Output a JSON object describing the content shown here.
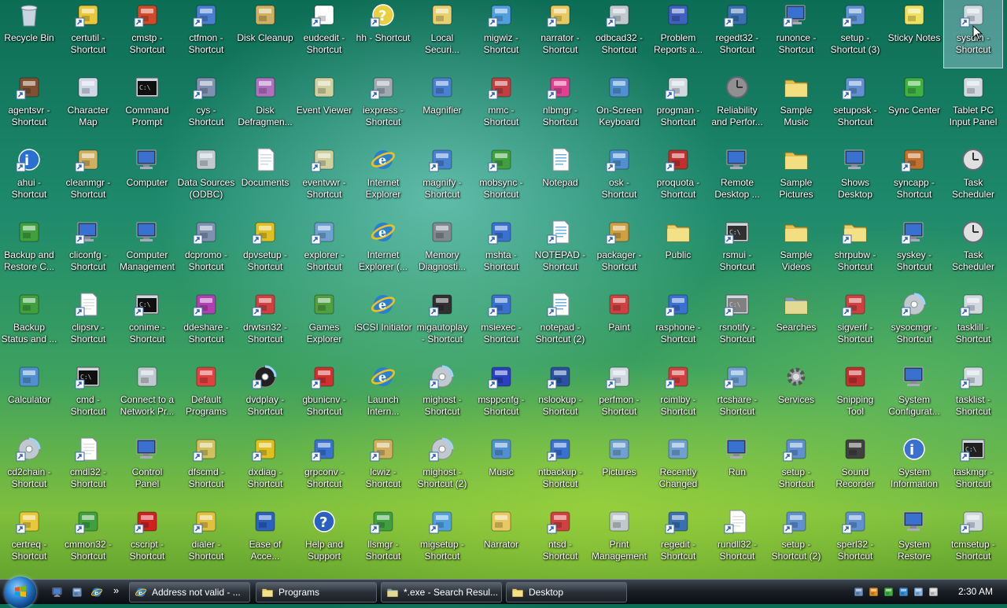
{
  "desktop": {
    "icons": [
      {
        "label": "Recycle Bin",
        "icon": "recycle-bin-icon",
        "color": "#c8d4e0"
      },
      {
        "label": "certutil -\nShortcut",
        "icon": "certificate-icon",
        "color": "#e8c83a"
      },
      {
        "label": "cmstp -\nShortcut",
        "icon": "connection-icon",
        "color": "#d04a2a"
      },
      {
        "label": "ctfmon -\nShortcut",
        "icon": "keyboard-window-icon",
        "color": "#4a7fd0"
      },
      {
        "label": "Disk Cleanup",
        "icon": "disk-cleanup-icon",
        "color": "#d0b060"
      },
      {
        "label": "eudcedit -\nShortcut",
        "icon": "char-editor-icon",
        "color": "#ffffff"
      },
      {
        "label": "hh - Shortcut",
        "icon": "help-file-icon",
        "color": "#e8d040"
      },
      {
        "label": "Local\nSecuri...",
        "icon": "security-policy-icon",
        "color": "#e8d070"
      },
      {
        "label": "migwiz -\nShortcut",
        "icon": "migration-icon",
        "color": "#50a0e0"
      },
      {
        "label": "narrator -\nShortcut",
        "icon": "narrator-icon",
        "color": "#e8c860"
      },
      {
        "label": "odbcad32 -\nShortcut",
        "icon": "odbc-icon",
        "color": "#c0c8d0"
      },
      {
        "label": "Problem\nReports a...",
        "icon": "problem-reports-icon",
        "color": "#4060c0"
      },
      {
        "label": "regedt32 -\nShortcut",
        "icon": "registry-icon",
        "color": "#3a70b0"
      },
      {
        "label": "runonce -\nShortcut",
        "icon": "computer-icon",
        "color": "#3a70d0"
      },
      {
        "label": "setup -\nShortcut (3)",
        "icon": "setup-icon",
        "color": "#6090d0"
      },
      {
        "label": "Sticky Notes",
        "icon": "sticky-notes-icon",
        "color": "#f0e060"
      },
      {
        "label": "sysdm -\nShortcut",
        "icon": "system-properties-icon",
        "color": "#d0d8e0"
      },
      {
        "label": "agentsvr -\nShortcut",
        "icon": "agent-icon",
        "color": "#805030"
      },
      {
        "label": "Character\nMap",
        "icon": "character-map-icon",
        "color": "#d0d8e8"
      },
      {
        "label": "Command\nPrompt",
        "icon": "command-prompt-icon",
        "color": "#101010"
      },
      {
        "label": "cys -\nShortcut",
        "icon": "server-icon",
        "color": "#8090b0"
      },
      {
        "label": "Disk\nDefragmen...",
        "icon": "defrag-icon",
        "color": "#b070c0"
      },
      {
        "label": "Event Viewer",
        "icon": "event-viewer-icon",
        "color": "#d0d0a0"
      },
      {
        "label": "iexpress -\nShortcut",
        "icon": "iexpress-icon",
        "color": "#a0a8b0"
      },
      {
        "label": "Magnifier",
        "icon": "magnifier-icon",
        "color": "#4a80d0"
      },
      {
        "label": "mmc -\nShortcut",
        "icon": "mmc-icon",
        "color": "#c04040"
      },
      {
        "label": "nlbmgr -\nShortcut",
        "icon": "pie-chart-icon",
        "color": "#e04090"
      },
      {
        "label": "On-Screen\nKeyboard",
        "icon": "on-screen-keyboard-icon",
        "color": "#5090d0"
      },
      {
        "label": "progman -\nShortcut",
        "icon": "program-manager-icon",
        "color": "#d0d8e0"
      },
      {
        "label": "Reliability\nand Perfor...",
        "icon": "gauge-icon",
        "color": "#909090"
      },
      {
        "label": "Sample\nMusic",
        "icon": "music-folder-icon",
        "color": "#e0c050"
      },
      {
        "label": "setuposk -\nShortcut",
        "icon": "setup-icon",
        "color": "#6090d0"
      },
      {
        "label": "Sync Center",
        "icon": "sync-center-icon",
        "color": "#40b040"
      },
      {
        "label": "Tablet PC\nInput Panel",
        "icon": "tablet-input-icon",
        "color": "#d0d8e0"
      },
      {
        "label": "ahui -\nShortcut",
        "icon": "info-icon",
        "color": "#2a70d0"
      },
      {
        "label": "cleanmgr -\nShortcut",
        "icon": "disk-cleanup-icon",
        "color": "#d0b060"
      },
      {
        "label": "Computer",
        "icon": "computer-icon",
        "color": "#3a70d0"
      },
      {
        "label": "Data Sources\n(ODBC)",
        "icon": "odbc-icon",
        "color": "#c0c8d0"
      },
      {
        "label": "Documents",
        "icon": "documents-icon",
        "color": "#d0d8e8"
      },
      {
        "label": "eventvwr -\nShortcut",
        "icon": "event-viewer-icon",
        "color": "#d0d0a0"
      },
      {
        "label": "Internet\nExplorer",
        "icon": "internet-explorer-icon",
        "color": "#2a80d0"
      },
      {
        "label": "magnify -\nShortcut",
        "icon": "magnifier-icon",
        "color": "#4a80d0"
      },
      {
        "label": "mobsync -\nShortcut",
        "icon": "sync-icon",
        "color": "#40a040"
      },
      {
        "label": "Notepad",
        "icon": "notepad-icon",
        "color": "#70b0e0"
      },
      {
        "label": "osk -\nShortcut",
        "icon": "on-screen-keyboard-icon",
        "color": "#5090d0"
      },
      {
        "label": "proquota -\nShortcut",
        "icon": "quota-icon",
        "color": "#c03030"
      },
      {
        "label": "Remote\nDesktop ...",
        "icon": "remote-desktop-icon",
        "color": "#3a70d0"
      },
      {
        "label": "Sample\nPictures",
        "icon": "pictures-folder-icon",
        "color": "#e0c050"
      },
      {
        "label": "Shows\nDesktop",
        "icon": "show-desktop-icon",
        "color": "#3a70d0"
      },
      {
        "label": "syncapp -\nShortcut",
        "icon": "briefcase-icon",
        "color": "#c07030"
      },
      {
        "label": "Task\nScheduler",
        "icon": "clock-icon",
        "color": "#e0e0e0"
      },
      {
        "label": "Backup and\nRestore C...",
        "icon": "backup-icon",
        "color": "#40a040"
      },
      {
        "label": "cliconfg -\nShortcut",
        "icon": "computer-icon",
        "color": "#3a70d0"
      },
      {
        "label": "Computer\nManagement",
        "icon": "computer-management-icon",
        "color": "#3a70d0"
      },
      {
        "label": "dcpromo -\nShortcut",
        "icon": "server-icon",
        "color": "#8090b0"
      },
      {
        "label": "dpvsetup -\nShortcut",
        "icon": "directx-icon",
        "color": "#e0c020"
      },
      {
        "label": "explorer -\nShortcut",
        "icon": "explorer-icon",
        "color": "#70a0d0"
      },
      {
        "label": "Internet\nExplorer (...",
        "icon": "internet-explorer-icon",
        "color": "#2a80d0"
      },
      {
        "label": "Memory\nDiagnosti...",
        "icon": "memory-icon",
        "color": "#808890"
      },
      {
        "label": "mshta -\nShortcut",
        "icon": "window-icon",
        "color": "#3a70d0"
      },
      {
        "label": "NOTEPAD -\nShortcut",
        "icon": "notepad-icon",
        "color": "#70b0e0"
      },
      {
        "label": "packager -\nShortcut",
        "icon": "package-icon",
        "color": "#d0a040"
      },
      {
        "label": "Public",
        "icon": "folder-icon",
        "color": "#e8d070"
      },
      {
        "label": "rsmui -\nShortcut",
        "icon": "storage-icon",
        "color": "#303030"
      },
      {
        "label": "Sample\nVideos",
        "icon": "videos-folder-icon",
        "color": "#e0c050"
      },
      {
        "label": "shrpubw -\nShortcut",
        "icon": "shared-folder-icon",
        "color": "#e8d070"
      },
      {
        "label": "syskey -\nShortcut",
        "icon": "key-computer-icon",
        "color": "#3a70d0"
      },
      {
        "label": "Task\nScheduler",
        "icon": "clock-icon",
        "color": "#e0e0e0"
      },
      {
        "label": "Backup\nStatus and ...",
        "icon": "backup-icon",
        "color": "#40a040"
      },
      {
        "label": "clipsrv -\nShortcut",
        "icon": "clipboard-icon",
        "color": "#e0e0e0"
      },
      {
        "label": "conime -\nShortcut",
        "icon": "command-prompt-icon",
        "color": "#101010"
      },
      {
        "label": "ddeshare -\nShortcut",
        "icon": "dde-icon",
        "color": "#b040b0"
      },
      {
        "label": "drwtsn32 -\nShortcut",
        "icon": "doctor-watson-icon",
        "color": "#d04040"
      },
      {
        "label": "Games\nExplorer",
        "icon": "games-icon",
        "color": "#50a040"
      },
      {
        "label": "iSCSI Initiator",
        "icon": "globe-icon",
        "color": "#2a80d0"
      },
      {
        "label": "migautoplay\n- Shortcut",
        "icon": "autoplay-icon",
        "color": "#303030"
      },
      {
        "label": "msiexec -\nShortcut",
        "icon": "installer-icon",
        "color": "#3a70d0"
      },
      {
        "label": "notepad -\nShortcut (2)",
        "icon": "notepad-icon",
        "color": "#70b0e0"
      },
      {
        "label": "Paint",
        "icon": "paint-icon",
        "color": "#d04040"
      },
      {
        "label": "rasphone -\nShortcut",
        "icon": "network-icon",
        "color": "#3a70d0"
      },
      {
        "label": "rsnotify -\nShortcut",
        "icon": "storage-icon",
        "color": "#808080"
      },
      {
        "label": "Searches",
        "icon": "search-folder-icon",
        "color": "#70a0d0"
      },
      {
        "label": "sigverif -\nShortcut",
        "icon": "signature-icon",
        "color": "#d04040"
      },
      {
        "label": "sysocmgr -\nShortcut",
        "icon": "cd-icon",
        "color": "#c0c8d0"
      },
      {
        "label": "tasklill -\nShortcut",
        "icon": "window-icon",
        "color": "#d0d8e0"
      },
      {
        "label": "Calculator",
        "icon": "calculator-icon",
        "color": "#5090d0"
      },
      {
        "label": "cmd -\nShortcut",
        "icon": "command-prompt-icon",
        "color": "#101010"
      },
      {
        "label": "Connect to a\nNetwork Pr...",
        "icon": "printer-icon",
        "color": "#c0c8d0"
      },
      {
        "label": "Default\nPrograms",
        "icon": "default-programs-icon",
        "color": "#e04040"
      },
      {
        "label": "dvdplay -\nShortcut",
        "icon": "dvd-icon",
        "color": "#202020"
      },
      {
        "label": "gbunicnv -\nShortcut",
        "icon": "chinese-char-icon",
        "color": "#d03030"
      },
      {
        "label": "Launch\nIntern...",
        "icon": "internet-explorer-icon",
        "color": "#2a80d0"
      },
      {
        "label": "mighost -\nShortcut",
        "icon": "cd-icon",
        "color": "#c0c8d0"
      },
      {
        "label": "msppcnfg -\nShortcut",
        "icon": "config-icon",
        "color": "#2a40c0"
      },
      {
        "label": "nslookup -\nShortcut",
        "icon": "network-tree-icon",
        "color": "#2a50a0"
      },
      {
        "label": "perfmon -\nShortcut",
        "icon": "performance-icon",
        "color": "#d0d8e0"
      },
      {
        "label": "rcimlby -\nShortcut",
        "icon": "ime-icon",
        "color": "#d04040"
      },
      {
        "label": "rtcshare -\nShortcut",
        "icon": "share-icon",
        "color": "#70a0d0"
      },
      {
        "label": "Services",
        "icon": "gear-icon",
        "color": "#a0a8b0"
      },
      {
        "label": "Snipping\nTool",
        "icon": "scissors-icon",
        "color": "#c03030"
      },
      {
        "label": "System\nConfigurat...",
        "icon": "system-config-icon",
        "color": "#3a70d0"
      },
      {
        "label": "tasklist -\nShortcut",
        "icon": "window-icon",
        "color": "#d0d8e0"
      },
      {
        "label": "cd2chain -\nShortcut",
        "icon": "cd-icon",
        "color": "#c0c8d0"
      },
      {
        "label": "cmdl32 -\nShortcut",
        "icon": "document-icon",
        "color": "#e0e0e0"
      },
      {
        "label": "Control\nPanel",
        "icon": "control-panel-icon",
        "color": "#3a70d0"
      },
      {
        "label": "dfscmd -\nShortcut",
        "icon": "dfs-icon",
        "color": "#d0c060"
      },
      {
        "label": "dxdiag -\nShortcut",
        "icon": "directx-icon",
        "color": "#e0c020"
      },
      {
        "label": "grpconv -\nShortcut",
        "icon": "program-group-icon",
        "color": "#3a70d0"
      },
      {
        "label": "lcwiz -\nShortcut",
        "icon": "wizard-icon",
        "color": "#d0b060"
      },
      {
        "label": "mighost -\nShortcut (2)",
        "icon": "cd-icon",
        "color": "#c0c8d0"
      },
      {
        "label": "Music",
        "icon": "music-icon",
        "color": "#5090d0"
      },
      {
        "label": "ntbackup -\nShortcut",
        "icon": "backup-tape-icon",
        "color": "#3a70d0"
      },
      {
        "label": "Pictures",
        "icon": "pictures-icon",
        "color": "#70a0d0"
      },
      {
        "label": "Recently\nChanged",
        "icon": "recent-icon",
        "color": "#70a0d0"
      },
      {
        "label": "Run",
        "icon": "run-icon",
        "color": "#3a70d0"
      },
      {
        "label": "setup -\nShortcut",
        "icon": "setup-icon",
        "color": "#6090d0"
      },
      {
        "label": "Sound\nRecorder",
        "icon": "microphone-icon",
        "color": "#404040"
      },
      {
        "label": "System\nInformation",
        "icon": "system-info-icon",
        "color": "#3a70d0"
      },
      {
        "label": "taskmgr -\nShortcut",
        "icon": "task-manager-icon",
        "color": "#202020"
      },
      {
        "label": "certreq -\nShortcut",
        "icon": "certificate-icon",
        "color": "#e8c83a"
      },
      {
        "label": "cmmon32 -\nShortcut",
        "icon": "connection-icon",
        "color": "#40a040"
      },
      {
        "label": "cscript -\nShortcut",
        "icon": "script-icon",
        "color": "#d02020"
      },
      {
        "label": "dialer -\nShortcut",
        "icon": "phone-icon",
        "color": "#e0c040"
      },
      {
        "label": "Ease of\nAcce...",
        "icon": "ease-of-access-icon",
        "color": "#2a60c0"
      },
      {
        "label": "Help and\nSupport",
        "icon": "help-icon",
        "color": "#2a60c0"
      },
      {
        "label": "llsmgr -\nShortcut",
        "icon": "license-icon",
        "color": "#40a040"
      },
      {
        "label": "migsetup -\nShortcut",
        "icon": "migration-icon",
        "color": "#50a0e0"
      },
      {
        "label": "Narrator",
        "icon": "narrator-icon",
        "color": "#e8c860"
      },
      {
        "label": "ntsd -\nShortcut",
        "icon": "debugger-icon",
        "color": "#d04040"
      },
      {
        "label": "Print\nManagement",
        "icon": "printer-icon",
        "color": "#c0c8d0"
      },
      {
        "label": "regedit -\nShortcut",
        "icon": "registry-icon",
        "color": "#3a70b0"
      },
      {
        "label": "rundll32 -\nShortcut",
        "icon": "dll-icon",
        "color": "#e0e0e0"
      },
      {
        "label": "setup -\nShortcut (2)",
        "icon": "setup-icon",
        "color": "#6090d0"
      },
      {
        "label": "sperl32 -\nShortcut",
        "icon": "setup-icon",
        "color": "#6090d0"
      },
      {
        "label": "System\nRestore",
        "icon": "system-restore-icon",
        "color": "#3a70d0"
      },
      {
        "label": "tcmsetup -\nShortcut",
        "icon": "window-icon",
        "color": "#d0d8e0"
      }
    ]
  },
  "taskbar": {
    "start_icon": "windows-logo-icon",
    "quick_launch": [
      {
        "icon": "show-desktop-icon",
        "color": "#4a80d0"
      },
      {
        "icon": "switch-windows-icon",
        "color": "#6a90c0"
      },
      {
        "icon": "internet-explorer-icon",
        "color": "#2a80d0"
      }
    ],
    "more_label": "»",
    "buttons": [
      {
        "label": "Address not valid - ...",
        "icon": "internet-explorer-icon",
        "color": "#2a80d0"
      },
      {
        "label": "Programs",
        "icon": "folder-icon",
        "color": "#e8d070"
      },
      {
        "label": "*.exe - Search Resul...",
        "icon": "search-folder-icon",
        "color": "#70a0d0"
      },
      {
        "label": "Desktop",
        "icon": "folder-icon",
        "color": "#e8d070"
      }
    ],
    "tray_icons": [
      {
        "icon": "network-tray-icon",
        "color": "#6a90c0"
      },
      {
        "icon": "shield-icon",
        "color": "#e09020"
      },
      {
        "icon": "checkmark-icon",
        "color": "#40b040"
      },
      {
        "icon": "windows-flag-tray-icon",
        "color": "#3a90d0"
      },
      {
        "icon": "monitor-tray-icon",
        "color": "#8ab0e0"
      },
      {
        "icon": "volume-muted-icon",
        "color": "#d0d0d0"
      }
    ],
    "clock": "2:30 AM"
  }
}
